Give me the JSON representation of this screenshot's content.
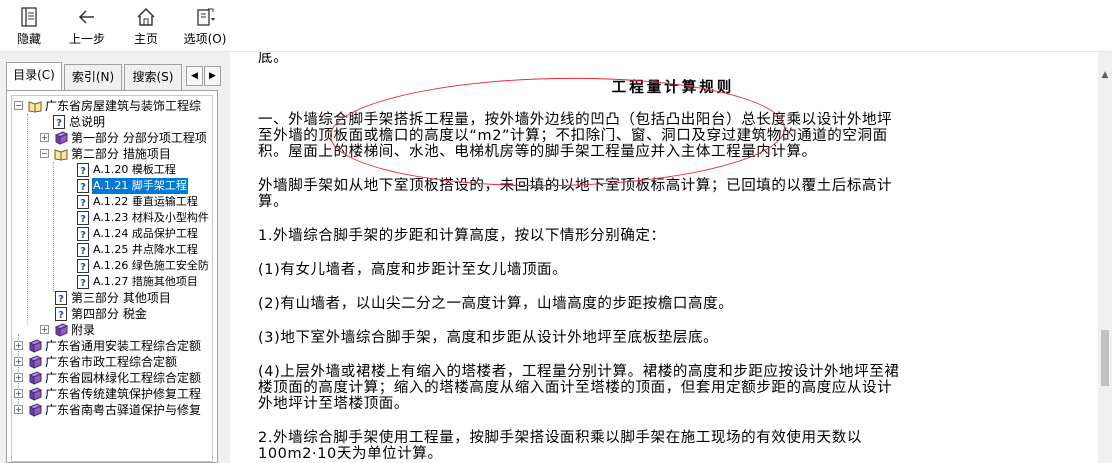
{
  "toolbar": {
    "hide": "隐藏",
    "back": "上一步",
    "home": "主页",
    "options": "选项(O)"
  },
  "tabs": {
    "contents": "目录(C)",
    "index": "索引(N)",
    "search": "搜索(S)"
  },
  "tree": {
    "root": "广东省房屋建筑与装饰工程综",
    "overview": "总说明",
    "part1": "第一部分 分部分项工程项",
    "part2": "第二部分 措施项目",
    "a120": "A.1.20 模板工程",
    "a121": "A.1.21 脚手架工程",
    "a122": "A.1.22 垂直运输工程",
    "a123": "A.1.23 材料及小型构件",
    "a124": "A.1.24 成品保护工程",
    "a125": "A.1.25 井点降水工程",
    "a126": "A.1.26 绿色施工安全防",
    "a127": "A.1.27 措施其他项目",
    "part3": "第三部分 其他项目",
    "part4": "第四部分 税金",
    "appendix": "附录",
    "b1": "广东省通用安装工程综合定额",
    "b2": "广东省市政工程综合定额",
    "b3": "广东省园林绿化工程综合定额",
    "b4": "广东省传统建筑保护修复工程",
    "b5": "广东省南粤古驿道保护与修复"
  },
  "doc": {
    "top_fragment": "底。",
    "title": "工程量计算规则",
    "p1_l1": "一、外墙综合脚手架搭拆工程量，按外墙外边线的凹凸（包括凸出阳台）总长度乘以设计外地坪",
    "p1_l2": "至外墙的顶板面或檐口的高度以“m2”计算；不扣除门、窗、洞口及穿过建筑物的通道的空洞面",
    "p1_l3": "积。屋面上的楼梯间、水池、电梯机房等的脚手架工程量应并入主体工程量内计算。",
    "p2_l1": "外墙脚手架如从地下室顶板搭设的，未回填的以地下室顶板标高计算；已回填的以覆土后标高计",
    "p2_l2": "算。",
    "p3": "1.外墙综合脚手架的步距和计算高度，按以下情形分别确定：",
    "p4": "(1)有女儿墙者，高度和步距计至女儿墙顶面。",
    "p5": "(2)有山墙者，以山尖二分之一高度计算，山墙高度的步距按檐口高度。",
    "p6": "(3)地下室外墙综合脚手架，高度和步距从设计外地坪至底板垫层底。",
    "p7_l1": "(4)上层外墙或裙楼上有缩入的塔楼者，工程量分别计算。裙楼的高度和步距应按设计外地坪至裙",
    "p7_l2": "楼顶面的高度计算；缩入的塔楼高度从缩入面计至塔楼的顶面，但套用定额步距的高度应从设计",
    "p7_l3": "外地坪计至塔楼顶面。",
    "p8_l1": "2.外墙综合脚手架使用工程量，按脚手架搭设面积乘以脚手架在施工现场的有效使用天数以",
    "p8_l2": "100m2·10天为单位计算。"
  },
  "colors": {
    "selection": "#0078d7",
    "annotation": "#e8293a"
  }
}
